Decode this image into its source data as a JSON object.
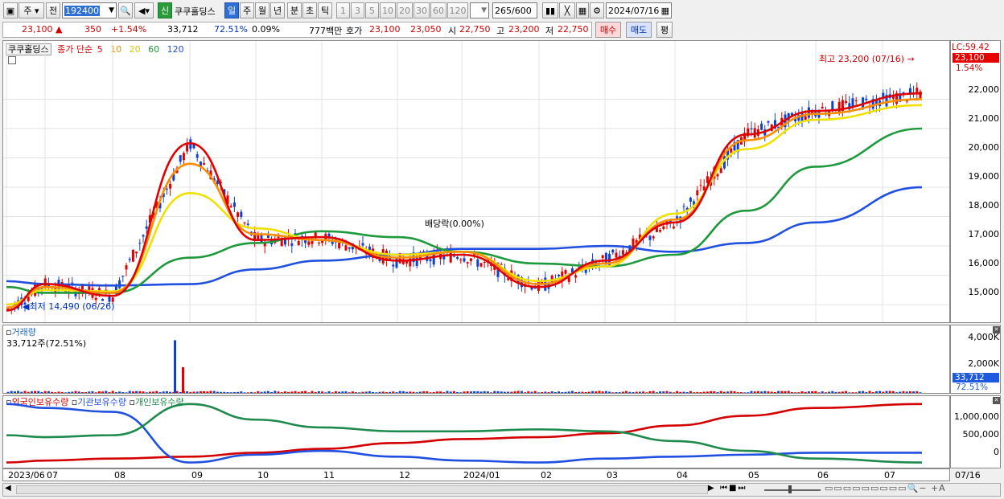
{
  "toolbar": {
    "market_label": "주",
    "prev_label": "전",
    "stock_code": "192400",
    "new_badge": "신",
    "stock_name": "쿠쿠홀딩스",
    "period_tabs": [
      "일",
      "주",
      "월",
      "년",
      "분",
      "초",
      "틱"
    ],
    "interval_buttons": [
      "1",
      "3",
      "5",
      "10",
      "20",
      "30",
      "60",
      "120"
    ],
    "count_value": "265",
    "count_total": "/600",
    "date_value": "2024/07/16"
  },
  "quote": {
    "price": "23,100",
    "change": "350",
    "change_pct": "+1.54%",
    "volume": "33,712",
    "volume_ratio": "72.51%",
    "turnover": "0.09%",
    "amount": "777백만",
    "hoga_label": "호가",
    "ask": "23,100",
    "bid": "23,050",
    "open_label": "시",
    "open": "22,750",
    "high_label": "고",
    "high": "23,200",
    "low_label": "저",
    "low": "22,750",
    "buy_button": "매수",
    "sell_button": "매도",
    "eval_button": "평"
  },
  "price_panel": {
    "name_tab": "쿠쿠홀딩스",
    "legend_prefix": "종가 단순",
    "ma_labels": [
      "5",
      "10",
      "20",
      "60",
      "120"
    ],
    "ma_colors": [
      "#e00000",
      "#ff8c00",
      "#f0e000",
      "#1e9a3c",
      "#2050e0"
    ],
    "lc_label": "LC:59.42",
    "current_price_tag": "23,100",
    "change_tag": "1.54%",
    "high_note": "최고 23,200 (07/16)",
    "low_note": "최저 14,490 (06/26)",
    "dividend_note": "배당락(0.00%)",
    "y_axis": [
      "22,000",
      "21,000",
      "20,000",
      "19,000",
      "18,000",
      "17,000",
      "16,000",
      "15,000"
    ]
  },
  "volume_panel": {
    "title": "거래량",
    "info": "33,712주(72.51%)",
    "y_axis": [
      "4,000K",
      "2,000K"
    ],
    "volume_tag": "33,712",
    "ratio_tag": "72.51%"
  },
  "holding_panel": {
    "legend": [
      "외국인보유수량",
      "기관보유수량",
      "개인보유수량"
    ],
    "legend_colors": [
      "#d40000",
      "#2050e0",
      "#1e8a4c"
    ],
    "y_axis": [
      "1,000,000",
      "500,000",
      "0"
    ]
  },
  "x_axis": [
    "2023/06",
    "07",
    "08",
    "09",
    "10",
    "11",
    "12",
    "2024/01",
    "02",
    "03",
    "04",
    "05",
    "06",
    "07"
  ],
  "x_axis_end": "07/16",
  "chart_data": {
    "type": "line",
    "title": "쿠쿠홀딩스",
    "x": [
      "2023/06",
      "07",
      "08",
      "09",
      "10",
      "11",
      "12",
      "2024/01",
      "02",
      "03",
      "04",
      "05",
      "06",
      "07"
    ],
    "ylim": [
      14400,
      23300
    ],
    "series": [
      {
        "name": "5",
        "values": [
          14800,
          15700,
          15300,
          20500,
          17200,
          17300,
          16500,
          16700,
          15600,
          16500,
          17800,
          20800,
          21600,
          22200
        ]
      },
      {
        "name": "10",
        "values": [
          14900,
          15600,
          15400,
          19800,
          17400,
          17200,
          16600,
          16800,
          15700,
          16400,
          17900,
          20600,
          21500,
          22000
        ]
      },
      {
        "name": "20",
        "values": [
          15000,
          15500,
          15450,
          18800,
          17600,
          17200,
          16700,
          16800,
          15800,
          16300,
          18100,
          20300,
          21300,
          21800
        ]
      },
      {
        "name": "60",
        "values": [
          15600,
          15400,
          15400,
          16600,
          17100,
          17500,
          17300,
          16800,
          16400,
          16300,
          16700,
          18200,
          19700,
          21000
        ]
      },
      {
        "name": "120",
        "values": [
          15800,
          15700,
          15650,
          15700,
          16200,
          16500,
          16700,
          16900,
          16900,
          17000,
          16800,
          17100,
          17800,
          19000
        ]
      }
    ],
    "annotations": {
      "high": {
        "date": "07/16",
        "value": 23200
      },
      "low": {
        "date": "06/26",
        "value": 14490
      }
    },
    "volume": {
      "ylim": [
        0,
        4500000
      ],
      "spikes": [
        {
          "month": "09",
          "value": 4100000
        },
        {
          "month": "09",
          "value": 2000000
        }
      ],
      "latest": 33712
    },
    "holdings": {
      "ylim": [
        -250000,
        1400000
      ],
      "series": [
        {
          "name": "외국인보유수량",
          "values": [
            -200000,
            -150000,
            -100000,
            -50000,
            50000,
            150000,
            300000,
            400000,
            450000,
            550000,
            750000,
            1000000,
            1200000,
            1300000
          ]
        },
        {
          "name": "기관보유수량",
          "values": [
            1300000,
            1200000,
            1100000,
            -200000,
            0,
            100000,
            -50000,
            -150000,
            -200000,
            -100000,
            -50000,
            0,
            50000,
            50000
          ]
        },
        {
          "name": "개인보유수량",
          "values": [
            500000,
            450000,
            500000,
            1300000,
            900000,
            700000,
            600000,
            600000,
            650000,
            600000,
            350000,
            100000,
            -100000,
            -200000
          ]
        }
      ]
    }
  }
}
